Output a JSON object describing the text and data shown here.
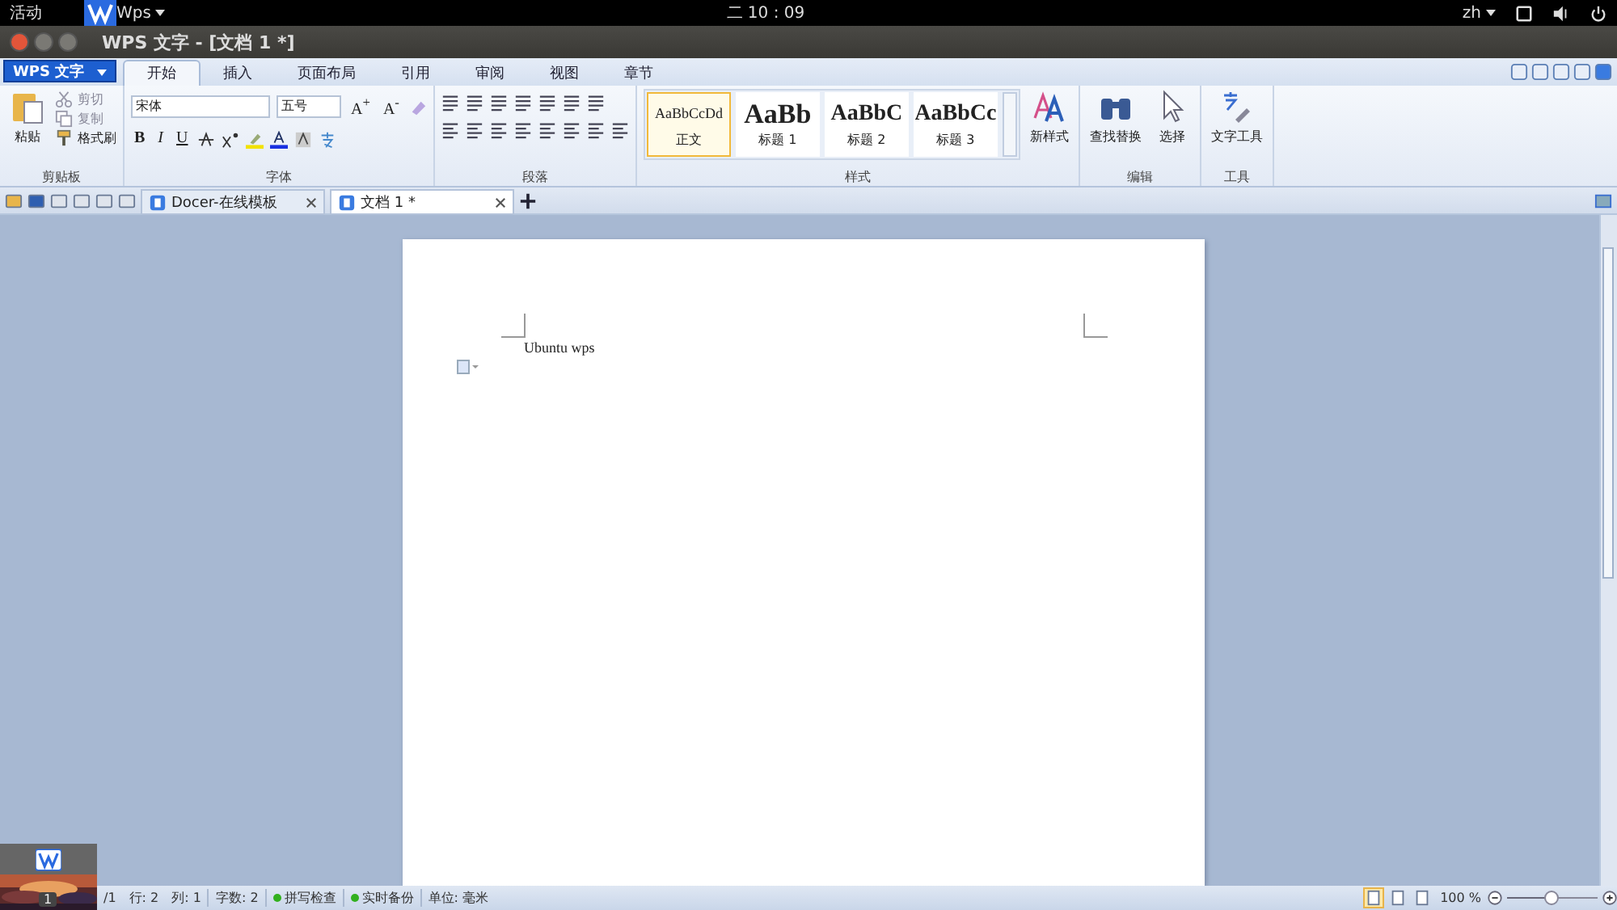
{
  "top_bar": {
    "activities": "活动",
    "app": "Wps",
    "clock": "二 10 : 09",
    "input_method": "zh"
  },
  "window": {
    "title": "WPS 文字 - [文档 1 *]"
  },
  "app_menu": "WPS 文字",
  "tabs": [
    {
      "label": "开始",
      "selected": true
    },
    {
      "label": "插入",
      "selected": false
    },
    {
      "label": "页面布局",
      "selected": false
    },
    {
      "label": "引用",
      "selected": false
    },
    {
      "label": "审阅",
      "selected": false
    },
    {
      "label": "视图",
      "selected": false
    },
    {
      "label": "章节",
      "selected": false
    }
  ],
  "ribbon": {
    "clipboard": {
      "paste": "粘贴",
      "cut": "剪切",
      "copy": "复制",
      "format_painter": "格式刷",
      "label": "剪贴板"
    },
    "font": {
      "family": "宋体",
      "size": "五号",
      "grow": "A$^{+}$",
      "shrink": "A$^{-}$",
      "bold": "B",
      "italic": "I",
      "underline": "U",
      "label": "字体"
    },
    "paragraph": {
      "label": "段落"
    },
    "styles": {
      "items": [
        {
          "preview": "AaBbCcDd",
          "name": "正文",
          "selected": true
        },
        {
          "preview": "AaBb",
          "name": "标题 1",
          "selected": false
        },
        {
          "preview": "AaBbC",
          "name": "标题 2",
          "selected": false
        },
        {
          "preview": "AaBbCc",
          "name": "标题 3",
          "selected": false
        }
      ],
      "new_style": "新样式",
      "label": "样式"
    },
    "editing": {
      "find_replace": "查找替换",
      "select": "选择",
      "label": "编辑"
    },
    "tools": {
      "text_tools": "文字工具",
      "label": "工具"
    }
  },
  "document_tabs": [
    {
      "title": "Docer-在线模板",
      "selected": false
    },
    {
      "title": "文档 1 *",
      "selected": true
    }
  ],
  "document": {
    "text": "Ubuntu wps"
  },
  "status_bar": {
    "page": "/1",
    "line": "行: 2",
    "column": "列: 1",
    "word_count": "字数: 2",
    "indicators": [
      {
        "label": "拼写检查",
        "on": true
      },
      {
        "label": "实时备份",
        "on": true
      }
    ],
    "unit": "单位: 毫米",
    "views": [
      {
        "selected": true
      },
      {
        "selected": false
      },
      {
        "selected": false
      }
    ],
    "zoom": "100 %",
    "zoom_slider": {
      "level": 0.5
    }
  },
  "taskbar": {
    "window_count": "1"
  }
}
